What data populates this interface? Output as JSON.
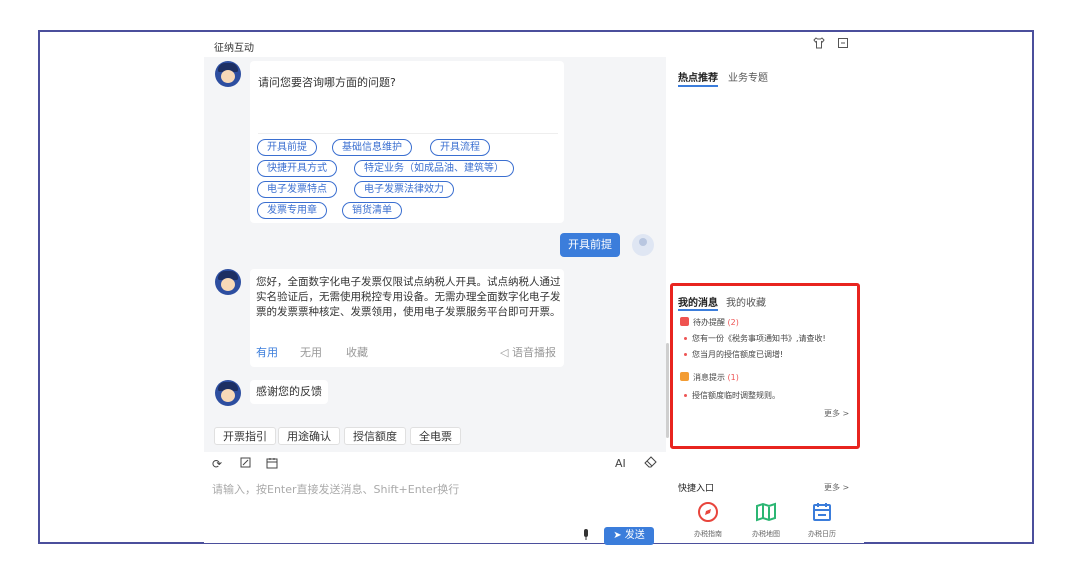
{
  "app": {
    "title": "征纳互动"
  },
  "chat": {
    "question": "请问您要咨询哪方面的问题?",
    "tags": [
      "开具前提",
      "基础信息维护",
      "开具流程",
      "快捷开具方式",
      "特定业务（如成品油、建筑等）",
      "电子发票特点",
      "电子发票法律效力",
      "发票专用章",
      "销货清单"
    ],
    "user_message": "开具前提",
    "answer": "您好，全面数字化电子发票仅限试点纳税人开具。试点纳税人通过实名验证后，无需使用税控专用设备。无需办理全面数字化电子发票的发票票种核定、发票领用，使用电子发票服务平台即可开票。",
    "feedback": {
      "useful": "有用",
      "useless": "无用",
      "collect": "收藏",
      "voice": "语音播报"
    },
    "thanks": "感谢您的反馈",
    "quick_actions": [
      "开票指引",
      "用途确认",
      "授信额度",
      "全电票"
    ]
  },
  "input": {
    "ai_label": "AI",
    "placeholder": "请输入，按Enter直接发送消息、Shift+Enter换行",
    "send": "发送"
  },
  "right": {
    "tabs": [
      "热点推荐",
      "业务专题"
    ],
    "msg_tabs": [
      "我的消息",
      "我的收藏"
    ],
    "todo": {
      "title": "待办提醒",
      "count": "(2)",
      "items": [
        "您有一份《税务事项通知书》,请查收!",
        "您当月的授信额度已调增!"
      ]
    },
    "notice": {
      "title": "消息提示",
      "count": "(1)",
      "items": [
        "授信额度临时调整规则。"
      ]
    },
    "more": "更多 >",
    "quick_entry": {
      "title": "快捷入口",
      "more": "更多 >",
      "items": [
        "办税指南",
        "办税地图",
        "办税日历"
      ]
    }
  },
  "colors": {
    "accent": "#3b7ddb",
    "highlight_border": "#e8241f",
    "frame_border": "#4b4f9c"
  }
}
